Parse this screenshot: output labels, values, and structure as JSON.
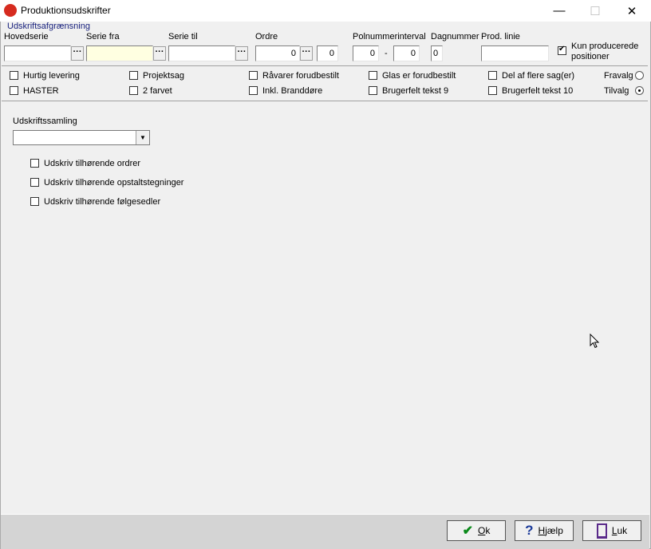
{
  "window": {
    "title": "Produktionsudskrifter",
    "minimize": "—",
    "maximize": "☐",
    "close": "✕"
  },
  "filter": {
    "group_title": "Udskriftsafgrænsning",
    "hovedserie": {
      "label": "Hovedserie",
      "value": ""
    },
    "serie_fra": {
      "label": "Serie fra",
      "value": ""
    },
    "serie_til": {
      "label": "Serie til",
      "value": ""
    },
    "ordre": {
      "label": "Ordre",
      "value_from": "0",
      "value_to": "0"
    },
    "polnummer": {
      "label": "Polnummerinterval",
      "from": "0",
      "dash": "-",
      "to": "0"
    },
    "dagnummer": {
      "label": "Dagnummer",
      "value": "0"
    },
    "prod_linie": {
      "label": "Prod. linie",
      "value": ""
    },
    "kun_producerede": {
      "label_line1": "Kun producerede",
      "label_line2": "positioner",
      "checked": true
    },
    "ellipsis": "···"
  },
  "options": {
    "row1": [
      "Hurtig levering",
      "Projektsag",
      "Råvarer forudbestilt",
      "Glas er forudbestilt",
      "Del af flere sag(er)"
    ],
    "row2": [
      "HASTER",
      "2 farvet",
      "Inkl. Branddøre",
      "Brugerfelt tekst 9",
      "Brugerfelt tekst 10"
    ],
    "fravalg": "Fravalg",
    "tilvalg": "Tilvalg",
    "selected_mode": "Tilvalg"
  },
  "main": {
    "udskriftssamling_label": "Udskriftssamling",
    "udskriftssamling_value": "",
    "checks": [
      "Udskriv tilhørende ordrer",
      "Udskriv tilhørende opstaltstegninger",
      "Udskriv tilhørende følgesedler"
    ]
  },
  "buttons": {
    "ok": "Ok",
    "help": "Hjælp",
    "close": "Luk"
  },
  "colors": {
    "accent_red": "#d62b1f",
    "group_title": "#1a237e",
    "field_yellow": "#ffffe1"
  }
}
